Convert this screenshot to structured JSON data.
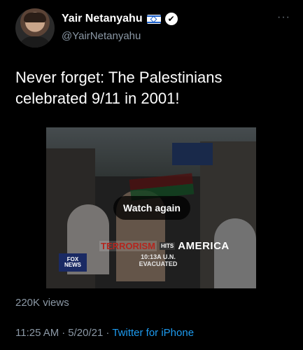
{
  "author": {
    "display_name": "Yair Netanyahu",
    "handle": "@YairNetanyahu",
    "verified_badge": "✔",
    "flag_icon": "israel-flag-icon",
    "more_label": "···"
  },
  "tweet": {
    "text": "Never forget: The Palestinians celebrated 9/11 in 2001!"
  },
  "video": {
    "overlay_button": "Watch again",
    "chyron_red": "TERRORISM",
    "chyron_small": "HITS",
    "chyron_big": "AMERICA",
    "logo_text": "FOX NEWS",
    "ticker_line1": "10:13A U.N.",
    "ticker_line2": "EVACUATED"
  },
  "stats": {
    "views": "220K views"
  },
  "meta": {
    "time": "11:25 AM",
    "sep1": "·",
    "date": "5/20/21",
    "sep2": "·",
    "source": "Twitter for iPhone"
  },
  "colors": {
    "background": "#000000",
    "secondary_text": "#8b98a5",
    "link": "#1d9bf0"
  }
}
